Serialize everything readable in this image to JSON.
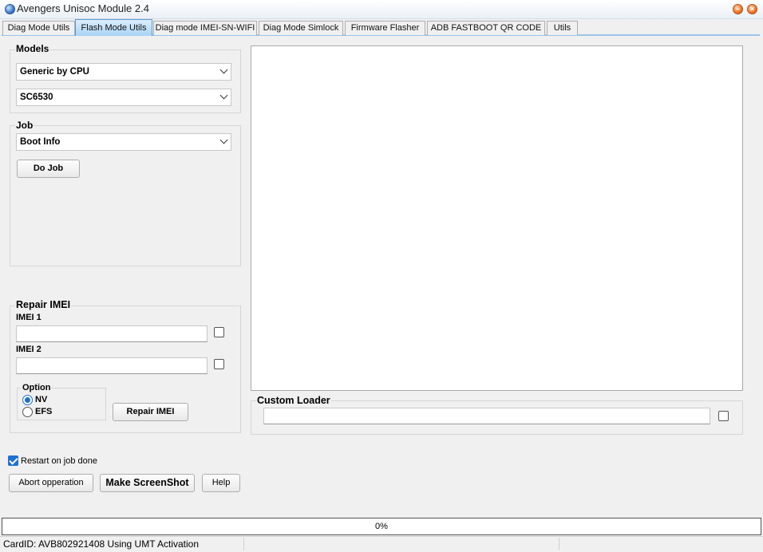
{
  "window": {
    "title": "Avengers Unisoc Module 2.4"
  },
  "tabs": [
    {
      "label": "Diag Mode Utils"
    },
    {
      "label": "Flash Mode Utils"
    },
    {
      "label": "Diag mode IMEI-SN-WIFI"
    },
    {
      "label": "Diag Mode Simlock"
    },
    {
      "label": "Firmware Flasher"
    },
    {
      "label": "ADB FASTBOOT QR CODE"
    },
    {
      "label": "Utils"
    }
  ],
  "models": {
    "label": "Models",
    "brand_value": "Generic by CPU",
    "cpu_value": "SC6530"
  },
  "job": {
    "label": "Job",
    "selected": "Boot Info",
    "do_job_label": "Do Job"
  },
  "repair_imei": {
    "label": "Repair IMEI",
    "imei1_label": "IMEI 1",
    "imei1_value": "",
    "imei2_label": "IMEI 2",
    "imei2_value": "",
    "option_label": "Option",
    "option_nv": "NV",
    "option_efs": "EFS",
    "selected_option": "NV",
    "repair_button": "Repair IMEI"
  },
  "custom_loader": {
    "label": "Custom Loader",
    "value": ""
  },
  "restart_on_job_done": {
    "label": "Restart on job done",
    "checked": true
  },
  "buttons": {
    "abort": "Abort opperation",
    "screenshot": "Make ScreenShot",
    "help": "Help"
  },
  "progress": {
    "text": "0%",
    "value": 0
  },
  "status": {
    "text": "CardID: AVB802921408 Using UMT Activation"
  }
}
